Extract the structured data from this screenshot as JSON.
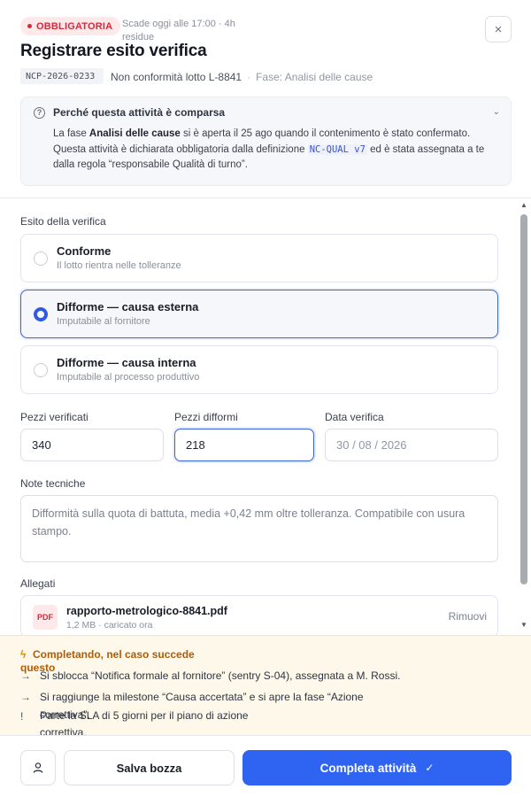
{
  "header": {
    "badge": "OBBLIGATORIA",
    "due": "Scade oggi alle 17:00 · 4h residue",
    "close_icon": "×",
    "title": "Registrare esito verifica",
    "code": "NCP-2026-0233",
    "subject": "Non conformità lotto L-8841",
    "separator": "·",
    "phase": "Fase: Analisi delle cause"
  },
  "why": {
    "title": "Perché questa attività è comparsa",
    "text_1": "La fase ",
    "text_bold": "Analisi delle cause",
    "text_2": " si è aperta il 25 ago quando il contenimento è stato confermato. Questa attività è dichiarata obbligatoria dalla definizione ",
    "text_code": "NC-QUAL v7",
    "text_3": " ed è stata assegnata a te dalla regola “responsabile Qualità di turno”."
  },
  "outcome": {
    "label": "Esito della verifica",
    "options": [
      {
        "title": "Conforme",
        "subtitle": "Il lotto rientra nelle tolleranze",
        "selected": false
      },
      {
        "title": "Difforme — causa esterna",
        "subtitle": "Imputabile al fornitore",
        "selected": true
      },
      {
        "title": "Difforme — causa interna",
        "subtitle": "Imputabile al processo produttivo",
        "selected": false
      }
    ]
  },
  "fields": {
    "checked_label": "Pezzi verificati",
    "checked_value": "340",
    "nonconforming_label": "Pezzi difformi",
    "nonconforming_value": "218",
    "date_label": "Data verifica",
    "date_value": "30 / 08 / 2026",
    "notes_label": "Note tecniche",
    "notes_value": "Difformità sulla quota di battuta, media +0,42 mm oltre tolleranza. Compatibile con usura stampo."
  },
  "attachments": {
    "label": "Allegati",
    "file_badge": "PDF",
    "file_name": "rapporto-metrologico-8841.pdf",
    "file_meta": "1,2 MB · caricato ora",
    "remove_label": "Rimuovi"
  },
  "consequences": {
    "title": "Completando, nel caso succede questo",
    "items": [
      {
        "icon": "→",
        "text": "Si sblocca “Notifica formale al fornitore” (sentry S-04), assegnata a M. Rossi."
      },
      {
        "icon": "→",
        "text": "Si raggiunge la milestone “Causa accertata” e si apre la fase “Azione correttiva”."
      },
      {
        "icon": "!",
        "text": "Parte la SLA di 5 giorni per il piano di azione correttiva."
      }
    ]
  },
  "footer": {
    "save_label": "Salva bozza",
    "complete_label": "Completa attività",
    "complete_icon": "✓"
  },
  "colors": {
    "primary": "#2f63f2",
    "danger": "#d52a3a",
    "warning_bg": "#fdf8ea",
    "warning_text": "#b05c07"
  }
}
